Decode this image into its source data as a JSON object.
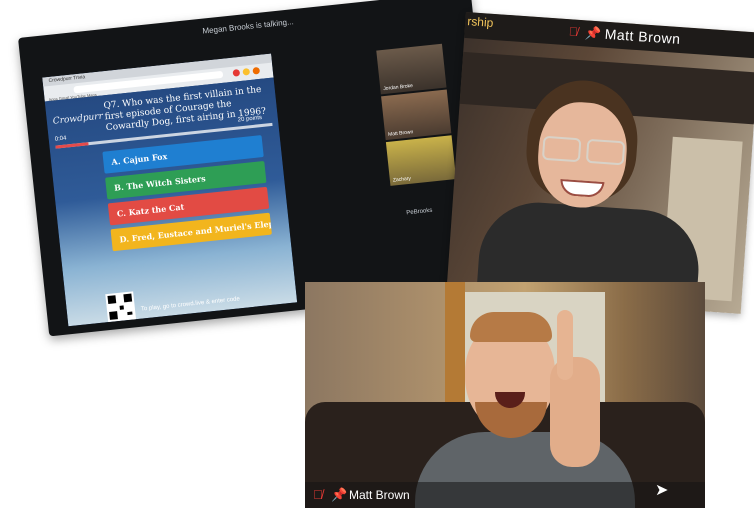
{
  "monitor": {
    "talking_banner": "Megan Brooks is talking...",
    "browser_tab": "Crowdpurr Trivia",
    "bookmarks": "Apps  Gmail  YouTube  Maps",
    "logo": "Crowdpurr",
    "question": "Q7. Who was the first villain in the first episode of Courage the Cowardly Dog, first airing in 1996?",
    "timer": "0:04",
    "points": "20 points",
    "timer_fraction": 0.15,
    "answers": [
      {
        "label": "A. Cajun Fox",
        "color": "#1f7fd1"
      },
      {
        "label": "B. The Witch Sisters",
        "color": "#2e9e55"
      },
      {
        "label": "C. Katz the Cat",
        "color": "#e24b44"
      },
      {
        "label": "D. Fred, Eustace and Muriel's Elephant",
        "color": "#f2b51d"
      }
    ],
    "bottom_text": "To play, go to crowd.live & enter code",
    "participants": [
      {
        "label": "Jordan Broke"
      },
      {
        "label": "Matt Brown"
      },
      {
        "label": "Zachary"
      }
    ],
    "side_label": "PeBrooks"
  },
  "top_camera": {
    "watermark": "rship",
    "name": "Matt Brown"
  },
  "bottom_camera": {
    "name": "Matt Brown"
  },
  "colors": {
    "mic_muted": "#e53935",
    "quiz_blue": "#254a82"
  },
  "icons": [
    "mic-muted-icon",
    "pin-icon",
    "cursor-icon",
    "qr-code"
  ]
}
